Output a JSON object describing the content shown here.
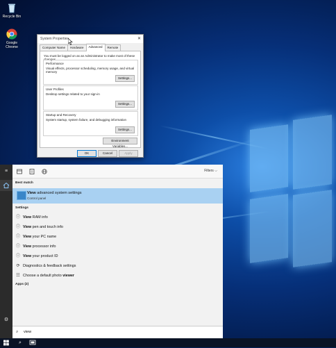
{
  "desktop": {
    "icons": [
      {
        "label": "Recycle Bin",
        "icon": "recycle-bin-icon"
      },
      {
        "label": "Google Chrome",
        "icon": "chrome-icon"
      }
    ]
  },
  "dialog": {
    "title": "System Properties",
    "close": "✕",
    "tabs": [
      "Computer Name",
      "Hardware",
      "Advanced",
      "Remote"
    ],
    "active_tab": "Advanced",
    "note": "You must be logged on as an Administrator to make most of these changes.",
    "groups": [
      {
        "title": "Performance",
        "desc": "Visual effects, processor scheduling, memory usage, and virtual memory",
        "button": "Settings..."
      },
      {
        "title": "User Profiles",
        "desc": "Desktop settings related to your sign-in",
        "button": "Settings..."
      },
      {
        "title": "Startup and Recovery",
        "desc": "System startup, system failure, and debugging information",
        "button": "Settings..."
      }
    ],
    "env_button": "Environment Variables...",
    "ok": "OK",
    "cancel": "Cancel",
    "apply": "Apply"
  },
  "search": {
    "filters_label": "Filters",
    "best_match_header": "Best match",
    "best_match": {
      "title_bold": "View",
      "title_rest": " advanced system settings",
      "subtitle": "Control panel"
    },
    "settings_header": "Settings",
    "settings_items": [
      {
        "bold": "View",
        "rest": " RAM info",
        "icon": "info-icon"
      },
      {
        "bold": "View",
        "rest": " pen and touch info",
        "icon": "info-icon"
      },
      {
        "bold": "View",
        "rest": " your PC name",
        "icon": "info-icon"
      },
      {
        "bold": "View",
        "rest": " processor info",
        "icon": "info-icon"
      },
      {
        "bold": "View",
        "rest": " your product ID",
        "icon": "info-icon"
      },
      {
        "pre": "Diagnostics & feedback settings",
        "icon": "diagnostics-icon"
      },
      {
        "pre": "Choose a default photo ",
        "bold": "viewer",
        "icon": "apps-icon"
      }
    ],
    "apps_header": "Apps (2)",
    "query": "view"
  },
  "taskbar": {
    "items": [
      "start-icon",
      "search-icon",
      "task-view-icon"
    ]
  }
}
